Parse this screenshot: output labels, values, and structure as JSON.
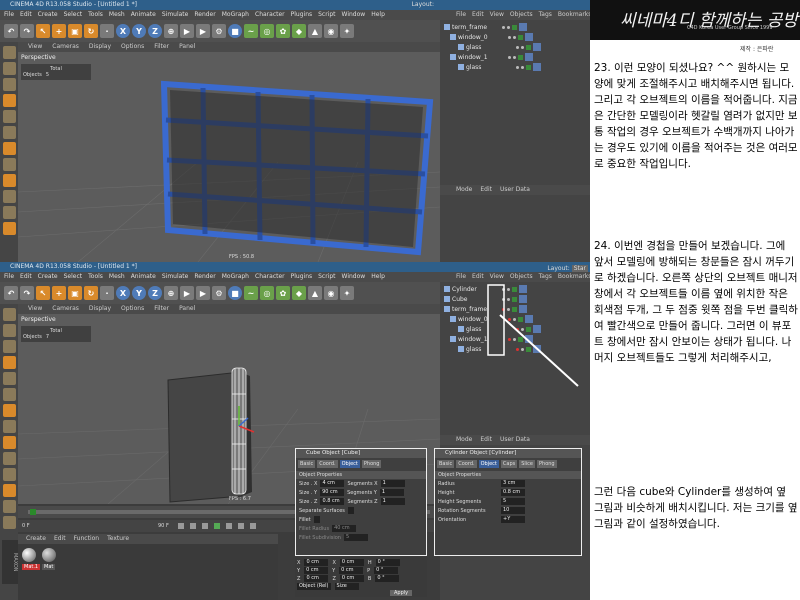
{
  "top_window": {
    "title": "CINEMA 4D R13.058 Studio - [Untitled 1 *]",
    "menu": [
      "File",
      "Edit",
      "Create",
      "Select",
      "Tools",
      "Mesh",
      "Animate",
      "Simulate",
      "Render",
      "MoGraph",
      "Character",
      "Plugins",
      "Script",
      "Window",
      "Help"
    ],
    "layout_label": "Layout:",
    "viewport_menu": [
      "View",
      "Cameras",
      "Display",
      "Options",
      "Filter",
      "Panel"
    ],
    "viewport_label": "Perspective",
    "stats_header": "Total",
    "stats_objects_label": "Objects",
    "stats_objects_value": "5",
    "fps": "FPS : 50.8",
    "om_menu": [
      "File",
      "Edit",
      "View",
      "Objects",
      "Tags",
      "Bookmarks"
    ],
    "objects": [
      "term_frame",
      "window_0",
      "glass",
      "window_1",
      "glass"
    ],
    "attr_menu": [
      "Mode",
      "Edit",
      "User Data"
    ]
  },
  "bottom_window": {
    "title": "CINEMA 4D R13.058 Studio - [Untitled 1 *]",
    "menu": [
      "File",
      "Edit",
      "Create",
      "Select",
      "Tools",
      "Mesh",
      "Animate",
      "Simulate",
      "Render",
      "MoGraph",
      "Character",
      "Plugins",
      "Script",
      "Window",
      "Help"
    ],
    "layout_label": "Layout:",
    "layout_value": "Star",
    "viewport_menu": [
      "View",
      "Cameras",
      "Display",
      "Options",
      "Filter",
      "Panel"
    ],
    "viewport_label": "Perspective",
    "stats_header": "Total",
    "stats_objects_label": "Objects",
    "stats_objects_value": "7",
    "fps": "FPS : 6.7",
    "om_menu": [
      "File",
      "Edit",
      "View",
      "Objects",
      "Tags",
      "Bookmarks"
    ],
    "objects": [
      "Cylinder",
      "Cube",
      "term_frame",
      "window_0",
      "glass",
      "window_1",
      "glass"
    ],
    "attr_menu": [
      "Mode",
      "Edit",
      "User Data"
    ],
    "material_menu": [
      "Create",
      "Edit",
      "Function",
      "Texture"
    ],
    "materials": [
      "Mat.1",
      "Mat"
    ],
    "maxon": "MAXON",
    "timeline_start": "0 F",
    "timeline_end": "90 F",
    "cube_dialog": {
      "title": "Cube Object [Cube]",
      "tabs": [
        "Basic",
        "Coord.",
        "Object",
        "Phong"
      ],
      "section": "Object Properties",
      "rows": [
        {
          "label": "Size . X",
          "value": "4 cm",
          "seg_label": "Segments X",
          "seg_value": "1"
        },
        {
          "label": "Size . Y",
          "value": "90 cm",
          "seg_label": "Segments Y",
          "seg_value": "1"
        },
        {
          "label": "Size . Z",
          "value": "0.8 cm",
          "seg_label": "Segments Z",
          "seg_value": "1"
        }
      ],
      "separate": "Separate Surfaces",
      "fillet": "Fillet",
      "fillet_radius": "Fillet Radius",
      "fillet_radius_value": "40 cm",
      "fillet_sub": "Fillet Subdivision",
      "fillet_sub_value": "5"
    },
    "cyl_dialog": {
      "title": "Cylinder Object [Cylinder]",
      "tabs": [
        "Basic",
        "Coord.",
        "Object",
        "Caps",
        "Slice",
        "Phong"
      ],
      "section": "Object Properties",
      "rows": [
        {
          "label": "Radius",
          "value": "3 cm"
        },
        {
          "label": "Height",
          "value": "0.8 cm"
        },
        {
          "label": "Height Segments",
          "value": "5"
        },
        {
          "label": "Rotation Segments",
          "value": "10"
        },
        {
          "label": "Orientation",
          "value": "+Y"
        }
      ]
    },
    "coords": {
      "rows": [
        {
          "a": "X",
          "av": "0 cm",
          "b": "X",
          "bv": "0 cm",
          "c": "H",
          "cv": "0 °"
        },
        {
          "a": "Y",
          "av": "0 cm",
          "b": "Y",
          "bv": "0 cm",
          "c": "P",
          "cv": "0 °"
        },
        {
          "a": "Z",
          "av": "0 cm",
          "b": "Z",
          "bv": "0 cm",
          "c": "B",
          "cv": "0 °"
        }
      ],
      "mode": "Object (Rel)",
      "size": "Size",
      "apply": "Apply"
    }
  },
  "tutorial": {
    "logo_text": "씨네마4디 함께하는 공방",
    "logo_sub": "C4D Korea User Group Since 1999",
    "credit": "제작 : 은파란",
    "paragraphs": [
      "23. 이런 모양이 되셨나요? ^^ 원하시는 모양에 맞게 조절해주시고 배치해주시면 됩니다. 그리고 각 오브젝트의 이름을 적어줍니다. 지금은 간단한 모델링이라 헷갈릴 염려가 없지만 보통 작업의 경우 오브젝트가 수백개까지 나아가는 경우도 있기에 이름을 적어주는 것은 여러모로 중요한 작업입니다.",
      "24. 이번엔 경첩을 만들어 보겠습니다. 그에 앞서 모델링에 방해되는 창문들은 잠시 꺼두기로 하겠습니다. 오른쪽 상단의 오브젝트 매니저창에서 각 오브젝트들 이름 옆에 위치한 작은 회색점 두개, 그 두 점중 윗쪽 점을 두번 클릭하여 빨간색으로 만들어 줍니다. 그러면 이 뷰포트 창에서만 잠시 안보이는 상태가 됩니다. 나머지 오브젝트들도 그렇게 처리해주시고,",
      "그런 다음 cube와 Cylinder를 생성하여 옆 그림과 비슷하게 배치시킵니다. 저는 크기를 옆 그림과 같이 설정하였습니다."
    ]
  },
  "colors": {
    "accent_blue": "#2e5f8a",
    "frame_blue": "#3a6ad0",
    "highlight_red": "#e03030"
  }
}
